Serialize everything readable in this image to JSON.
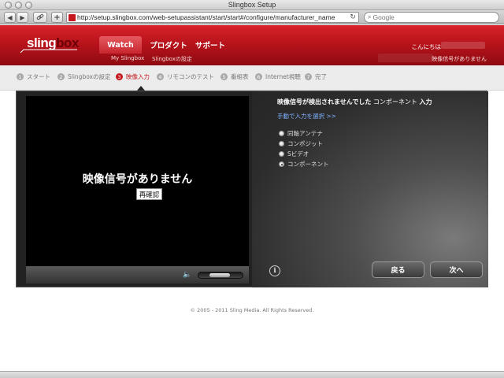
{
  "window": {
    "title": "Slingbox Setup"
  },
  "browser": {
    "back_icon": "◀",
    "forward_icon": "▶",
    "url": "http://setup.slingbox.com/web-setupassistant/start/start#/configure/manufacturer_name",
    "search_placeholder": "Google"
  },
  "header": {
    "logo_part1": "sling",
    "logo_part2": "box",
    "nav": [
      {
        "label": "Watch"
      },
      {
        "label": "プロダクト"
      },
      {
        "label": "サポート"
      }
    ],
    "greeting": "こんにちは",
    "subnav": [
      {
        "label": "My Slingbox"
      },
      {
        "label": "Slingboxの設定"
      }
    ],
    "status": "映像信号がありません"
  },
  "steps": [
    {
      "num": "1",
      "label": "スタート"
    },
    {
      "num": "2",
      "label": "Slingboxの設定"
    },
    {
      "num": "3",
      "label": "映像入力"
    },
    {
      "num": "4",
      "label": "リモコンのテスト"
    },
    {
      "num": "5",
      "label": "番組表"
    },
    {
      "num": "6",
      "label": "Internet視聴"
    },
    {
      "num": "7",
      "label": "完了"
    }
  ],
  "player": {
    "no_signal": "映像信号がありません",
    "recheck_label": "再確認"
  },
  "input_panel": {
    "title_prefix": "映像信号が検出されませんでした",
    "title_source": "コンポーネント",
    "title_suffix": "入力",
    "manual_link": "手動で入力を選択 >>",
    "options": [
      {
        "label": "同軸アンテナ",
        "checked": false
      },
      {
        "label": "コンポジット",
        "checked": false
      },
      {
        "label": "Sビデオ",
        "checked": false
      },
      {
        "label": "コンポーネント",
        "checked": true
      }
    ],
    "info_icon": "i",
    "back_label": "戻る",
    "next_label": "次へ"
  },
  "footer": {
    "copyright": "© 2005 - 2011 Sling Media. All Rights Reserved."
  }
}
